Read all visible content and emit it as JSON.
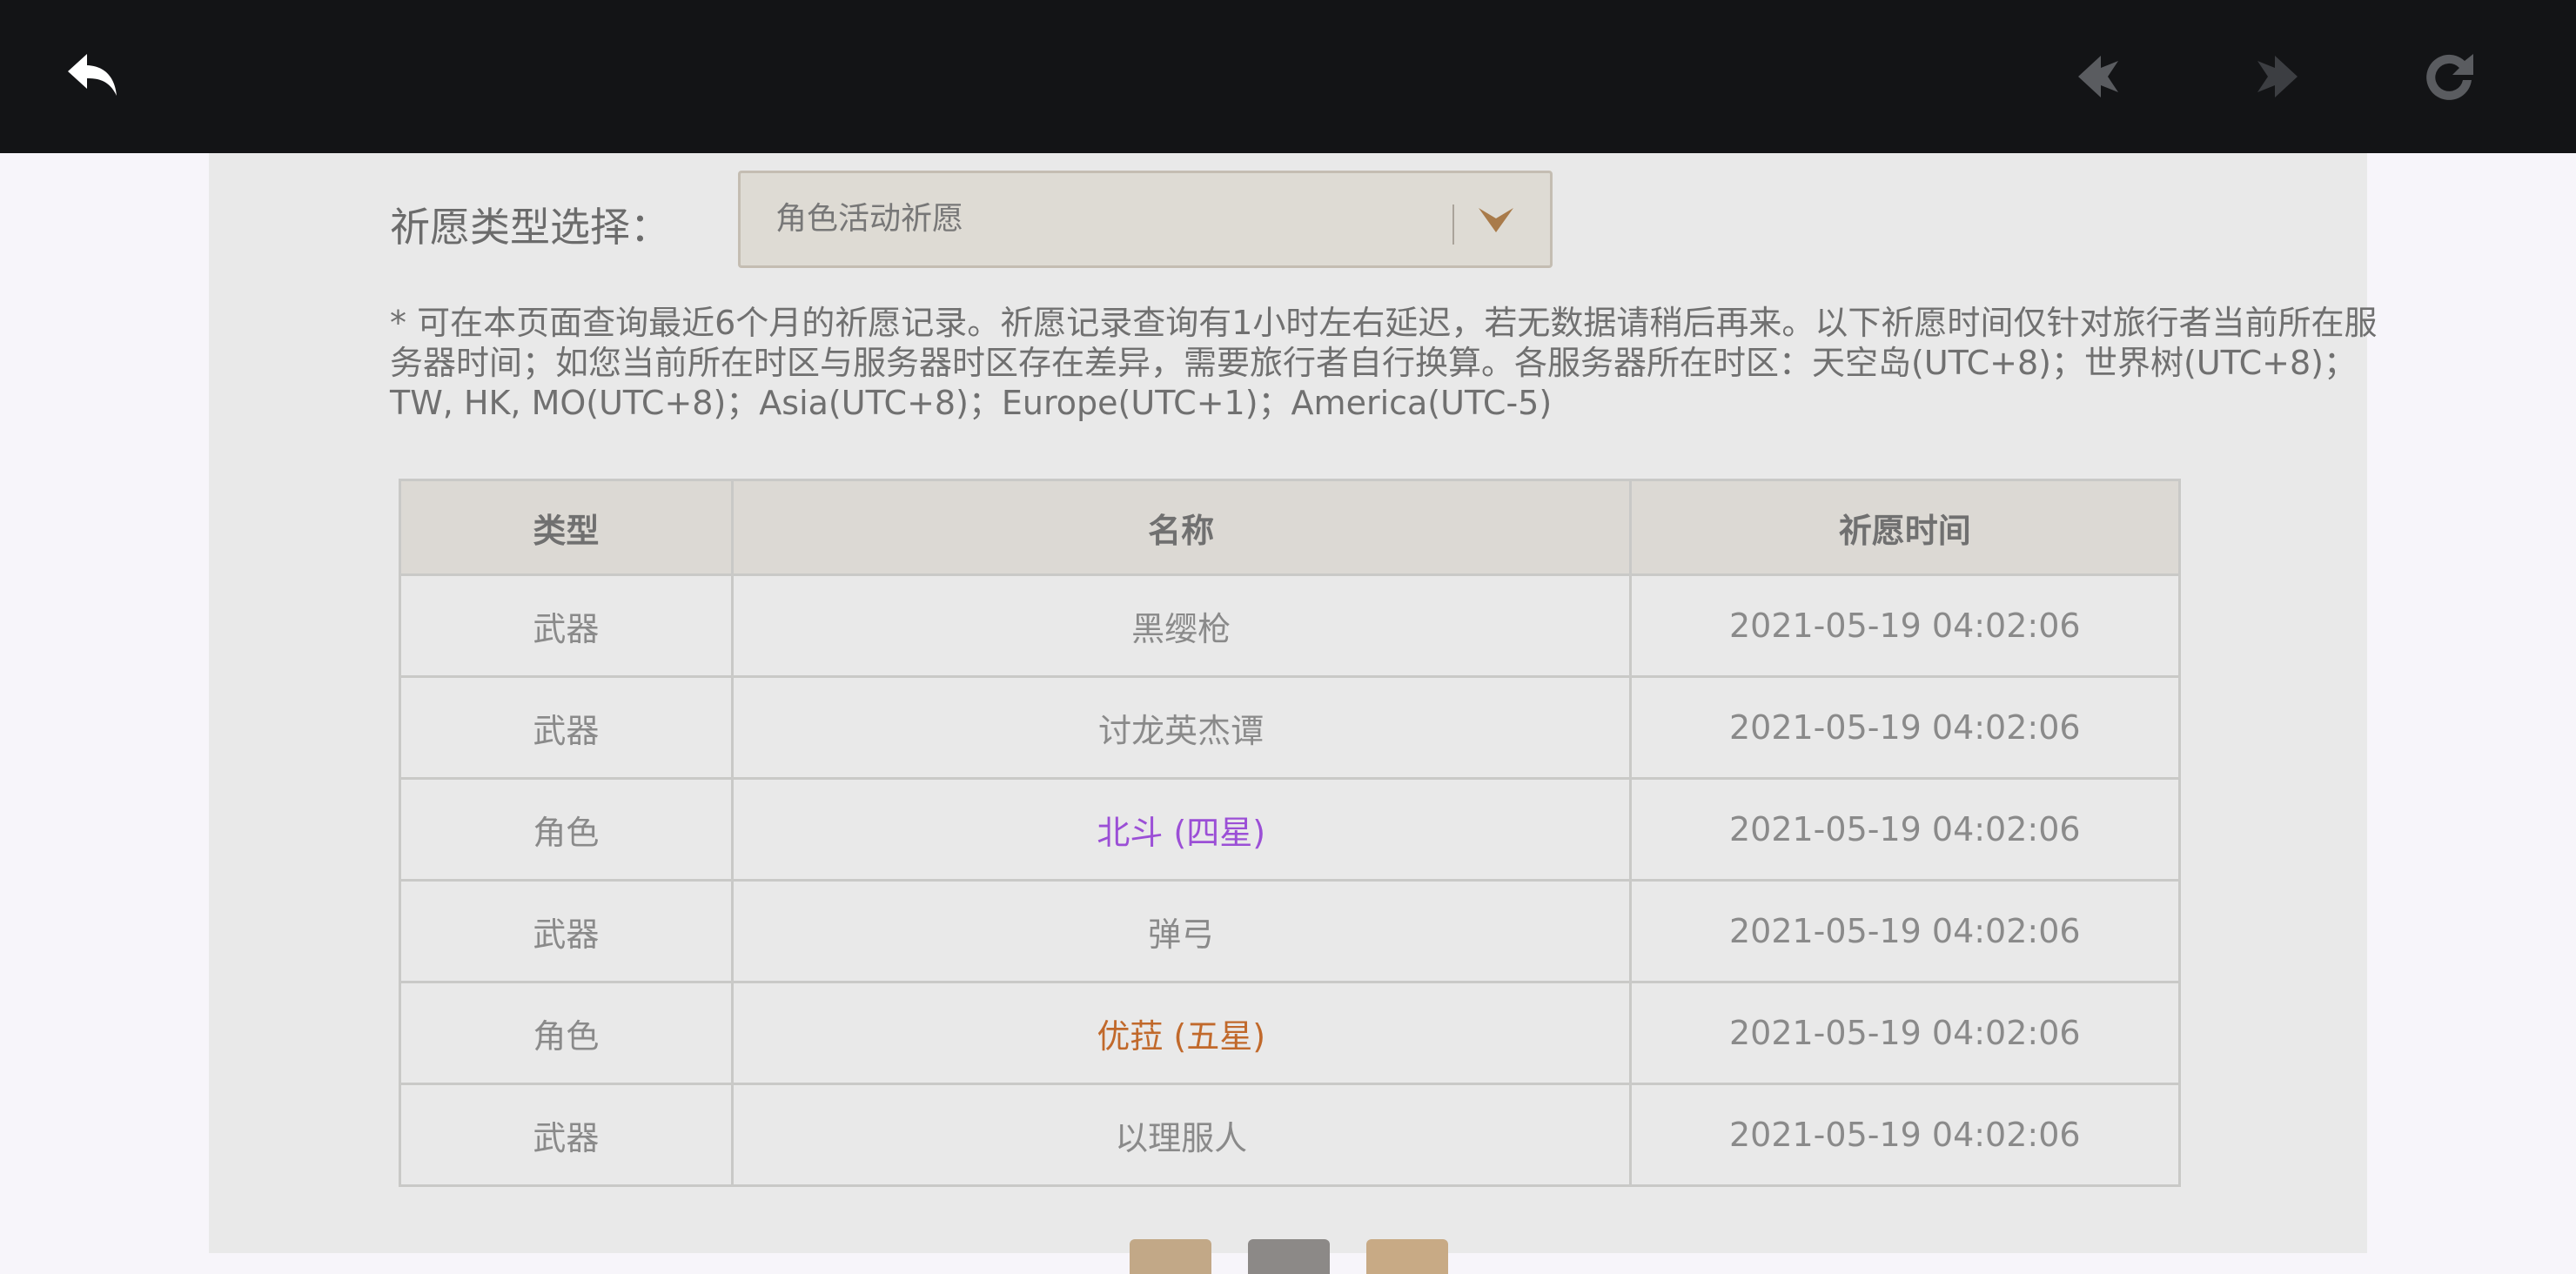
{
  "colors": {
    "topbar": "#131416",
    "purple_rarity": "#9b4fd6",
    "gold_rarity": "#c1692b",
    "cell_text": "#8a8a8a"
  },
  "toolbar": {
    "back_icon": "back-arrow-icon",
    "prev_icon": "prev-arrow-icon",
    "next_icon": "next-arrow-icon",
    "refresh_icon": "refresh-icon"
  },
  "filter": {
    "label": "祈愿类型选择：",
    "selected": "角色活动祈愿",
    "icon": "chevron-down-icon"
  },
  "notice": "* 可在本页面查询最近6个月的祈愿记录。祈愿记录查询有1小时左右延迟，若无数据请稍后再来。以下祈愿时间仅针对旅行者当前所在服务器时间；如您当前所在时区与服务器时区存在差异，需要旅行者自行换算。各服务器所在时区：天空岛(UTC+8)；世界树(UTC+8)；TW, HK, MO(UTC+8)；Asia(UTC+8)；Europe(UTC+1)；America(UTC-5)",
  "table": {
    "headers": [
      "类型",
      "名称",
      "祈愿时间"
    ],
    "rows": [
      {
        "type": "武器",
        "name": "黑缨枪",
        "time": "2021-05-19 04:02:06",
        "rarity": "normal"
      },
      {
        "type": "武器",
        "name": "讨龙英杰谭",
        "time": "2021-05-19 04:02:06",
        "rarity": "normal"
      },
      {
        "type": "角色",
        "name": "北斗 (四星)",
        "time": "2021-05-19 04:02:06",
        "rarity": "purple"
      },
      {
        "type": "武器",
        "name": "弹弓",
        "time": "2021-05-19 04:02:06",
        "rarity": "normal"
      },
      {
        "type": "角色",
        "name": "优菈 (五星)",
        "time": "2021-05-19 04:02:06",
        "rarity": "gold"
      },
      {
        "type": "武器",
        "name": "以理服人",
        "time": "2021-05-19 04:02:06",
        "rarity": "normal"
      }
    ]
  }
}
